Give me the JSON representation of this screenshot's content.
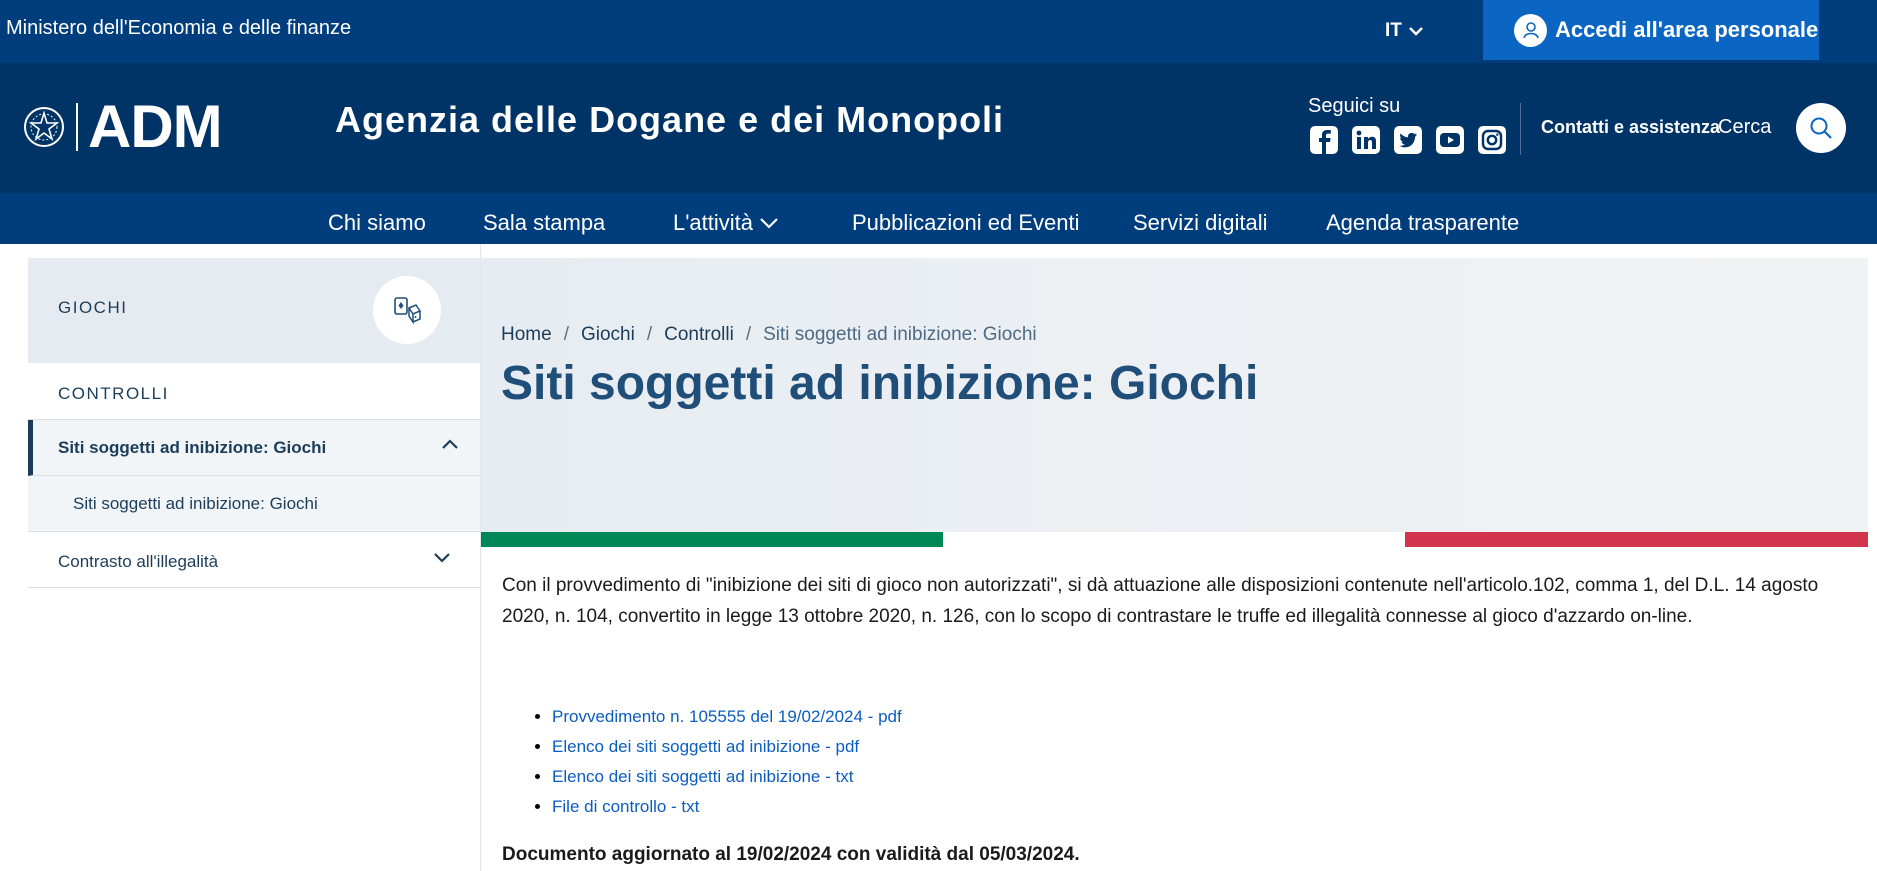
{
  "slim": {
    "owner": "Ministero dell'Economia e delle finanze",
    "lang": "IT",
    "login": "Accedi all'area personale"
  },
  "header": {
    "brand": "ADM",
    "site_title": "Agenzia delle Dogane e dei Monopoli",
    "social_label": "Seguici su",
    "social_icons": [
      "facebook-icon",
      "linkedin-icon",
      "twitter-icon",
      "youtube-icon",
      "instagram-icon"
    ],
    "contacts": "Contatti e assistenza",
    "search_label": "Cerca"
  },
  "nav": {
    "items": [
      "Chi siamo",
      "Sala stampa",
      "L'attività",
      "Pubblicazioni ed Eventi",
      "Servizi digitali",
      "Agenda trasparente"
    ]
  },
  "sidebar": {
    "section": "GIOCHI",
    "controlli": "CONTROLLI",
    "active": "Siti soggetti ad inibizione: Giochi",
    "sub": "Siti soggetti ad inibizione: Giochi",
    "contrasto": "Contrasto all'illegalità"
  },
  "breadcrumb": [
    "Home",
    "Giochi",
    "Controlli",
    "Siti soggetti ad inibizione: Giochi"
  ],
  "main": {
    "title": "Siti soggetti ad inibizione: Giochi",
    "intro": "Con il provvedimento di \"inibizione dei siti di gioco non autorizzati\", si dà attuazione alle disposizioni contenute nell'articolo.102, comma 1, del D.L. 14 agosto 2020, n. 104, convertito in legge 13 ottobre 2020, n. 126, con lo scopo di contrastare le truffe ed illegalità connesse al gioco d'azzardo on-line.",
    "links": [
      "Provvedimento n. 105555 del 19/02/2024 - pdf",
      "Elenco dei siti soggetti ad inibizione - pdf",
      "Elenco dei siti soggetti ad inibizione - txt",
      "File di controllo - txt"
    ],
    "updated": "Documento aggiornato al 19/02/2024 con validità dal 05/03/2024."
  },
  "colors": {
    "slim_bar": "#003d7c",
    "header": "#003366",
    "login": "#0a66c2",
    "title": "#1f4e79",
    "link": "#0a5dc2",
    "flag_green": "#008758",
    "flag_red": "#d1344c"
  }
}
